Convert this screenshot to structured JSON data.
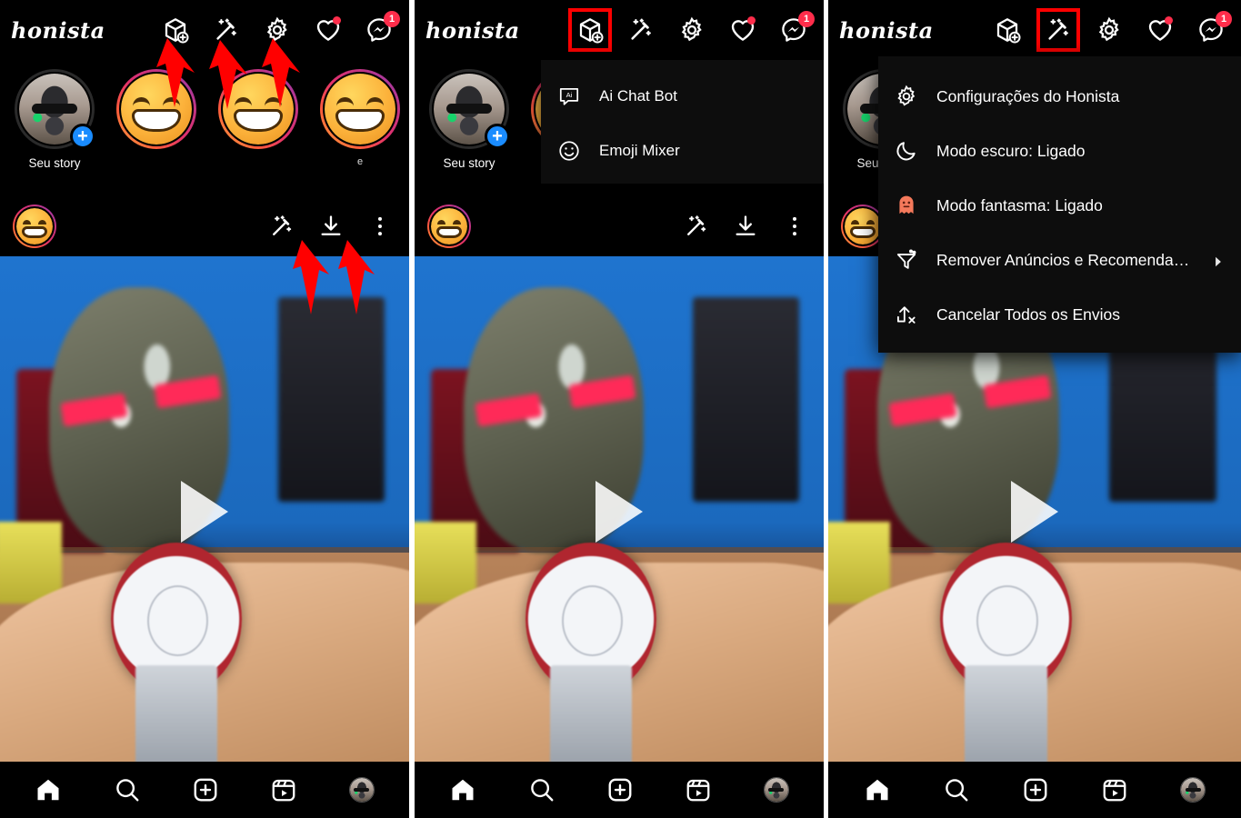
{
  "app": {
    "name": "honista",
    "logo_text": "honista",
    "accent_red": "#ff0000",
    "badge_red": "#ff2d4b",
    "menu_bg": "#0d0d0d",
    "ghost_color": "#f4795b"
  },
  "header": {
    "logo": "honista",
    "icons": [
      {
        "name": "cube-plus-icon",
        "label": "Honista Tools"
      },
      {
        "name": "magic-wand-icon",
        "label": "Honista Menu"
      },
      {
        "name": "gear-icon",
        "label": "Configurações"
      },
      {
        "name": "heart-icon",
        "label": "Atividade",
        "badge_dot": true
      },
      {
        "name": "messenger-icon",
        "label": "Direct",
        "badge_count": "1"
      }
    ]
  },
  "stories": {
    "own_label": "Seu story",
    "items": [
      {
        "label": "Seu story",
        "type": "avatar",
        "has_plus": true
      },
      {
        "label": "",
        "type": "emoji"
      },
      {
        "label": "",
        "type": "emoji"
      },
      {
        "label": "e",
        "type": "emoji"
      }
    ]
  },
  "post": {
    "toolbar_icons": [
      {
        "name": "magic-wand-icon",
        "label": "Honista tools"
      },
      {
        "name": "download-icon",
        "label": "Baixar"
      },
      {
        "name": "more-options-icon",
        "label": "Mais opções"
      }
    ],
    "media_type": "video",
    "play_label": "Reproduzir"
  },
  "bottom_nav": [
    {
      "name": "home-icon",
      "label": "Início",
      "active": true
    },
    {
      "name": "search-icon",
      "label": "Pesquisar",
      "active": false
    },
    {
      "name": "add-post-icon",
      "label": "Criar",
      "active": false
    },
    {
      "name": "reels-icon",
      "label": "Reels",
      "active": false
    },
    {
      "name": "profile-avatar",
      "label": "Perfil",
      "active": false
    }
  ],
  "menus": {
    "tools_menu": {
      "opened_from": "cube-plus-icon",
      "items": [
        {
          "icon": "ai-chat-icon",
          "label": "Ai Chat Bot"
        },
        {
          "icon": "emoji-mixer-icon",
          "label": "Emoji Mixer"
        }
      ]
    },
    "main_menu": {
      "opened_from": "magic-wand-icon",
      "items": [
        {
          "icon": "gear-icon",
          "label": "Configurações do Honista",
          "chevron": false
        },
        {
          "icon": "moon-icon",
          "label": "Modo escuro: Ligado",
          "chevron": false
        },
        {
          "icon": "ghost-icon",
          "label": "Modo fantasma: Ligado",
          "chevron": false
        },
        {
          "icon": "filter-icon",
          "label": "Remover Anúncios e Recomendaçõ..",
          "chevron": true
        },
        {
          "icon": "cancel-upload-icon",
          "label": "Cancelar Todos os Envios",
          "chevron": false
        }
      ]
    }
  },
  "annotations": {
    "arrow_color": "#ff0000",
    "panel1_arrows": [
      {
        "points_to": "cube-plus-icon"
      },
      {
        "points_to": "magic-wand-icon"
      },
      {
        "points_to": "gear-icon"
      },
      {
        "points_to": "post-magic-wand-icon"
      },
      {
        "points_to": "post-download-icon"
      }
    ],
    "panel2_highlight": "cube-plus-icon",
    "panel3_highlight": "magic-wand-icon"
  }
}
